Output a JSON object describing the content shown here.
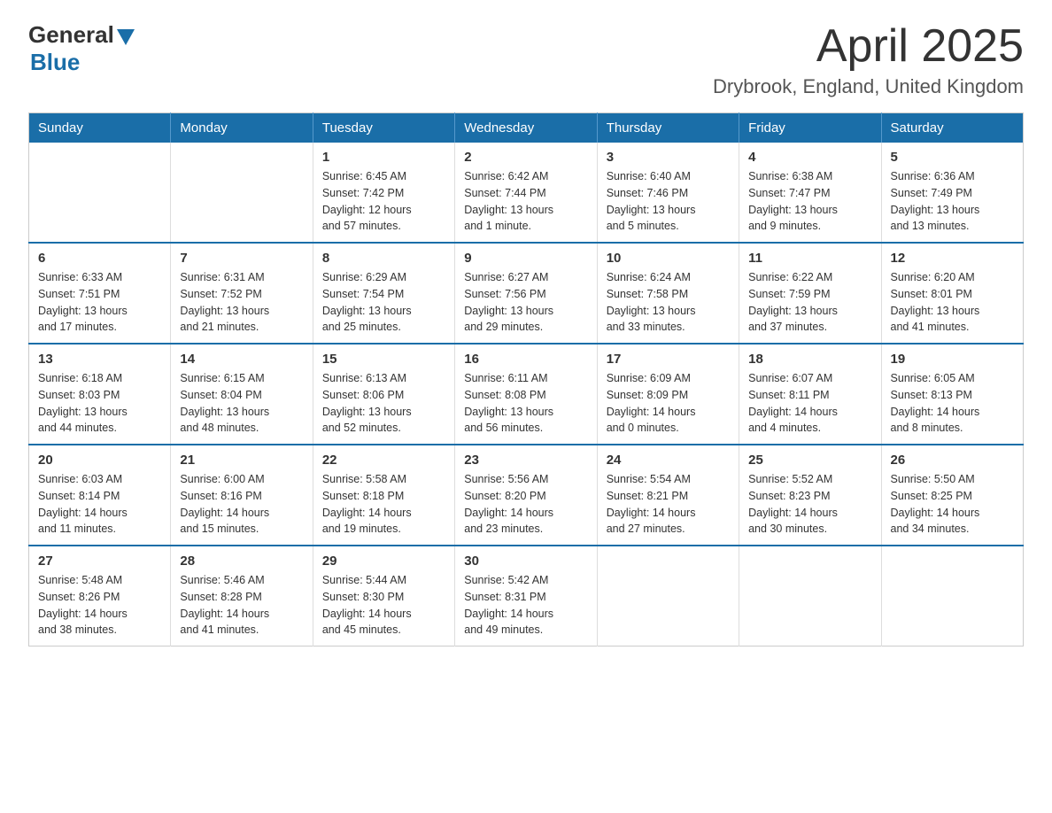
{
  "logo": {
    "general": "General",
    "blue": "Blue"
  },
  "title": "April 2025",
  "location": "Drybrook, England, United Kingdom",
  "headers": [
    "Sunday",
    "Monday",
    "Tuesday",
    "Wednesday",
    "Thursday",
    "Friday",
    "Saturday"
  ],
  "weeks": [
    [
      {
        "day": "",
        "info": ""
      },
      {
        "day": "",
        "info": ""
      },
      {
        "day": "1",
        "info": "Sunrise: 6:45 AM\nSunset: 7:42 PM\nDaylight: 12 hours\nand 57 minutes."
      },
      {
        "day": "2",
        "info": "Sunrise: 6:42 AM\nSunset: 7:44 PM\nDaylight: 13 hours\nand 1 minute."
      },
      {
        "day": "3",
        "info": "Sunrise: 6:40 AM\nSunset: 7:46 PM\nDaylight: 13 hours\nand 5 minutes."
      },
      {
        "day": "4",
        "info": "Sunrise: 6:38 AM\nSunset: 7:47 PM\nDaylight: 13 hours\nand 9 minutes."
      },
      {
        "day": "5",
        "info": "Sunrise: 6:36 AM\nSunset: 7:49 PM\nDaylight: 13 hours\nand 13 minutes."
      }
    ],
    [
      {
        "day": "6",
        "info": "Sunrise: 6:33 AM\nSunset: 7:51 PM\nDaylight: 13 hours\nand 17 minutes."
      },
      {
        "day": "7",
        "info": "Sunrise: 6:31 AM\nSunset: 7:52 PM\nDaylight: 13 hours\nand 21 minutes."
      },
      {
        "day": "8",
        "info": "Sunrise: 6:29 AM\nSunset: 7:54 PM\nDaylight: 13 hours\nand 25 minutes."
      },
      {
        "day": "9",
        "info": "Sunrise: 6:27 AM\nSunset: 7:56 PM\nDaylight: 13 hours\nand 29 minutes."
      },
      {
        "day": "10",
        "info": "Sunrise: 6:24 AM\nSunset: 7:58 PM\nDaylight: 13 hours\nand 33 minutes."
      },
      {
        "day": "11",
        "info": "Sunrise: 6:22 AM\nSunset: 7:59 PM\nDaylight: 13 hours\nand 37 minutes."
      },
      {
        "day": "12",
        "info": "Sunrise: 6:20 AM\nSunset: 8:01 PM\nDaylight: 13 hours\nand 41 minutes."
      }
    ],
    [
      {
        "day": "13",
        "info": "Sunrise: 6:18 AM\nSunset: 8:03 PM\nDaylight: 13 hours\nand 44 minutes."
      },
      {
        "day": "14",
        "info": "Sunrise: 6:15 AM\nSunset: 8:04 PM\nDaylight: 13 hours\nand 48 minutes."
      },
      {
        "day": "15",
        "info": "Sunrise: 6:13 AM\nSunset: 8:06 PM\nDaylight: 13 hours\nand 52 minutes."
      },
      {
        "day": "16",
        "info": "Sunrise: 6:11 AM\nSunset: 8:08 PM\nDaylight: 13 hours\nand 56 minutes."
      },
      {
        "day": "17",
        "info": "Sunrise: 6:09 AM\nSunset: 8:09 PM\nDaylight: 14 hours\nand 0 minutes."
      },
      {
        "day": "18",
        "info": "Sunrise: 6:07 AM\nSunset: 8:11 PM\nDaylight: 14 hours\nand 4 minutes."
      },
      {
        "day": "19",
        "info": "Sunrise: 6:05 AM\nSunset: 8:13 PM\nDaylight: 14 hours\nand 8 minutes."
      }
    ],
    [
      {
        "day": "20",
        "info": "Sunrise: 6:03 AM\nSunset: 8:14 PM\nDaylight: 14 hours\nand 11 minutes."
      },
      {
        "day": "21",
        "info": "Sunrise: 6:00 AM\nSunset: 8:16 PM\nDaylight: 14 hours\nand 15 minutes."
      },
      {
        "day": "22",
        "info": "Sunrise: 5:58 AM\nSunset: 8:18 PM\nDaylight: 14 hours\nand 19 minutes."
      },
      {
        "day": "23",
        "info": "Sunrise: 5:56 AM\nSunset: 8:20 PM\nDaylight: 14 hours\nand 23 minutes."
      },
      {
        "day": "24",
        "info": "Sunrise: 5:54 AM\nSunset: 8:21 PM\nDaylight: 14 hours\nand 27 minutes."
      },
      {
        "day": "25",
        "info": "Sunrise: 5:52 AM\nSunset: 8:23 PM\nDaylight: 14 hours\nand 30 minutes."
      },
      {
        "day": "26",
        "info": "Sunrise: 5:50 AM\nSunset: 8:25 PM\nDaylight: 14 hours\nand 34 minutes."
      }
    ],
    [
      {
        "day": "27",
        "info": "Sunrise: 5:48 AM\nSunset: 8:26 PM\nDaylight: 14 hours\nand 38 minutes."
      },
      {
        "day": "28",
        "info": "Sunrise: 5:46 AM\nSunset: 8:28 PM\nDaylight: 14 hours\nand 41 minutes."
      },
      {
        "day": "29",
        "info": "Sunrise: 5:44 AM\nSunset: 8:30 PM\nDaylight: 14 hours\nand 45 minutes."
      },
      {
        "day": "30",
        "info": "Sunrise: 5:42 AM\nSunset: 8:31 PM\nDaylight: 14 hours\nand 49 minutes."
      },
      {
        "day": "",
        "info": ""
      },
      {
        "day": "",
        "info": ""
      },
      {
        "day": "",
        "info": ""
      }
    ]
  ]
}
